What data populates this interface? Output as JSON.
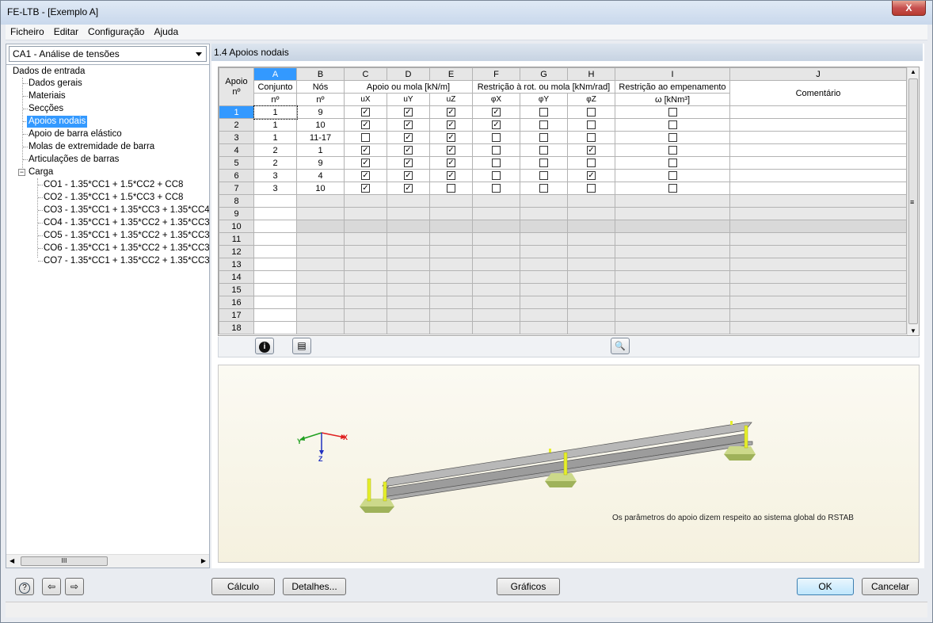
{
  "window": {
    "title": "FE-LTB - [Exemplo A]",
    "close_glyph": "X"
  },
  "menu": [
    "Ficheiro",
    "Editar",
    "Configuração",
    "Ajuda"
  ],
  "case_selector": {
    "value": "CA1 - Análise de tensões"
  },
  "tree": {
    "root": "Dados de entrada",
    "items": [
      "Dados gerais",
      "Materiais",
      "Secções",
      "Apoios nodais",
      "Apoio de barra elástico",
      "Molas de extremidade de barra",
      "Articulações de barras"
    ],
    "load_group": "Carga",
    "load_collapse_glyph": "−",
    "load_items": [
      "CO1 - 1.35*CC1 + 1.5*CC2 + CC8",
      "CO2 - 1.35*CC1 + 1.5*CC3 + CC8",
      "CO3 - 1.35*CC1 + 1.35*CC3 + 1.35*CC4",
      "CO4 - 1.35*CC1 + 1.35*CC2 + 1.35*CC3",
      "CO5 - 1.35*CC1 + 1.35*CC2 + 1.35*CC3",
      "CO6 - 1.35*CC1 + 1.35*CC2 + 1.35*CC3",
      "CO7 - 1.35*CC1 + 1.35*CC2 + 1.35*CC3"
    ],
    "hscroll_grip": "III"
  },
  "section": {
    "title": "1.4 Apoios nodais"
  },
  "table": {
    "col_letters": [
      "A",
      "B",
      "C",
      "D",
      "E",
      "F",
      "G",
      "H",
      "I",
      "J"
    ],
    "hdr_row_label1": "Apoio",
    "hdr_row_label2": "nº",
    "hdr_conjunto": "Conjunto",
    "hdr_conjunto2": "nº",
    "hdr_nos": "Nós",
    "hdr_nos2": "nº",
    "hdr_apoio_mola": "Apoio ou mola [kN/m]",
    "hdr_restricao_rot": "Restrição à rot. ou mola [kNm/rad]",
    "hdr_restricao_emp": "Restrição ao empenamento",
    "hdr_omega": "ω [kNm³]",
    "hdr_comentario": "Comentário",
    "sub": [
      "uX",
      "uY",
      "uZ",
      "φX",
      "φY",
      "φZ"
    ],
    "rows": [
      {
        "n": "1",
        "set": "1",
        "nodes": "9",
        "ux": true,
        "uy": true,
        "uz": true,
        "px": true,
        "py": false,
        "pz": false,
        "w": false
      },
      {
        "n": "2",
        "set": "1",
        "nodes": "10",
        "ux": true,
        "uy": true,
        "uz": true,
        "px": true,
        "py": false,
        "pz": false,
        "w": false
      },
      {
        "n": "3",
        "set": "1",
        "nodes": "11-17",
        "ux": false,
        "uy": true,
        "uz": true,
        "px": false,
        "py": false,
        "pz": false,
        "w": false
      },
      {
        "n": "4",
        "set": "2",
        "nodes": "1",
        "ux": true,
        "uy": true,
        "uz": true,
        "px": false,
        "py": false,
        "pz": true,
        "w": false
      },
      {
        "n": "5",
        "set": "2",
        "nodes": "9",
        "ux": true,
        "uy": true,
        "uz": true,
        "px": false,
        "py": false,
        "pz": false,
        "w": false
      },
      {
        "n": "6",
        "set": "3",
        "nodes": "4",
        "ux": true,
        "uy": true,
        "uz": true,
        "px": false,
        "py": false,
        "pz": true,
        "w": false
      },
      {
        "n": "7",
        "set": "3",
        "nodes": "10",
        "ux": true,
        "uy": true,
        "uz": false,
        "px": false,
        "py": false,
        "pz": false,
        "w": false
      }
    ],
    "empty_rows": [
      "8",
      "9",
      "10",
      "11",
      "12",
      "13",
      "14",
      "15",
      "16",
      "17",
      "18"
    ],
    "check_glyph": "✓",
    "scroll_up": "▲",
    "scroll_down": "▼",
    "scroll_grip": "≡"
  },
  "toolbar": {
    "info_icon": "i",
    "edit_icon": "▤",
    "view_icon": "🔍"
  },
  "graphic": {
    "note": "Os parâmetros do apoio dizem respeito ao sistema global do RSTAB",
    "axis_x": "X",
    "axis_y": "Y",
    "axis_z": "Z"
  },
  "buttons": {
    "calculo": "Cálculo",
    "detalhes": "Detalhes...",
    "graficos": "Gráficos",
    "ok": "OK",
    "cancelar": "Cancelar",
    "help_icon": "?",
    "prev_icon": "⇦",
    "next_icon": "⇨"
  }
}
